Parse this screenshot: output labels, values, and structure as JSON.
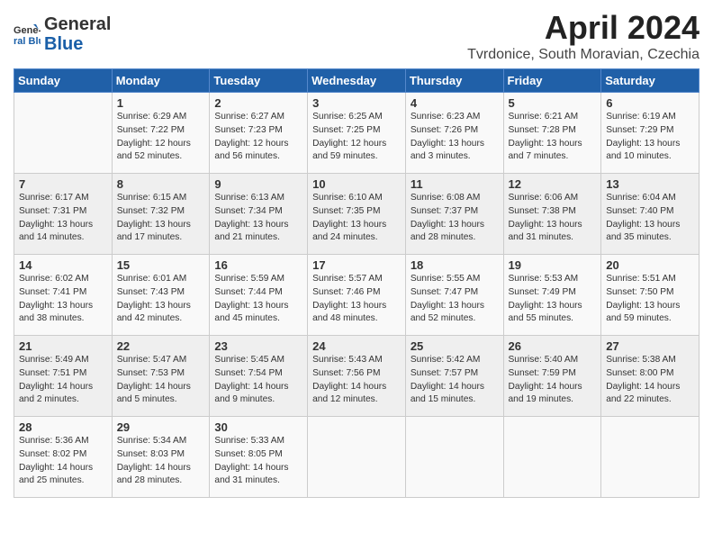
{
  "header": {
    "logo_general": "General",
    "logo_blue": "Blue",
    "title": "April 2024",
    "subtitle": "Tvrdonice, South Moravian, Czechia"
  },
  "weekdays": [
    "Sunday",
    "Monday",
    "Tuesday",
    "Wednesday",
    "Thursday",
    "Friday",
    "Saturday"
  ],
  "weeks": [
    [
      {
        "day": "",
        "sunrise": "",
        "sunset": "",
        "daylight": ""
      },
      {
        "day": "1",
        "sunrise": "6:29 AM",
        "sunset": "7:22 PM",
        "daylight": "12 hours and 52 minutes."
      },
      {
        "day": "2",
        "sunrise": "6:27 AM",
        "sunset": "7:23 PM",
        "daylight": "12 hours and 56 minutes."
      },
      {
        "day": "3",
        "sunrise": "6:25 AM",
        "sunset": "7:25 PM",
        "daylight": "12 hours and 59 minutes."
      },
      {
        "day": "4",
        "sunrise": "6:23 AM",
        "sunset": "7:26 PM",
        "daylight": "13 hours and 3 minutes."
      },
      {
        "day": "5",
        "sunrise": "6:21 AM",
        "sunset": "7:28 PM",
        "daylight": "13 hours and 7 minutes."
      },
      {
        "day": "6",
        "sunrise": "6:19 AM",
        "sunset": "7:29 PM",
        "daylight": "13 hours and 10 minutes."
      }
    ],
    [
      {
        "day": "7",
        "sunrise": "6:17 AM",
        "sunset": "7:31 PM",
        "daylight": "13 hours and 14 minutes."
      },
      {
        "day": "8",
        "sunrise": "6:15 AM",
        "sunset": "7:32 PM",
        "daylight": "13 hours and 17 minutes."
      },
      {
        "day": "9",
        "sunrise": "6:13 AM",
        "sunset": "7:34 PM",
        "daylight": "13 hours and 21 minutes."
      },
      {
        "day": "10",
        "sunrise": "6:10 AM",
        "sunset": "7:35 PM",
        "daylight": "13 hours and 24 minutes."
      },
      {
        "day": "11",
        "sunrise": "6:08 AM",
        "sunset": "7:37 PM",
        "daylight": "13 hours and 28 minutes."
      },
      {
        "day": "12",
        "sunrise": "6:06 AM",
        "sunset": "7:38 PM",
        "daylight": "13 hours and 31 minutes."
      },
      {
        "day": "13",
        "sunrise": "6:04 AM",
        "sunset": "7:40 PM",
        "daylight": "13 hours and 35 minutes."
      }
    ],
    [
      {
        "day": "14",
        "sunrise": "6:02 AM",
        "sunset": "7:41 PM",
        "daylight": "13 hours and 38 minutes."
      },
      {
        "day": "15",
        "sunrise": "6:01 AM",
        "sunset": "7:43 PM",
        "daylight": "13 hours and 42 minutes."
      },
      {
        "day": "16",
        "sunrise": "5:59 AM",
        "sunset": "7:44 PM",
        "daylight": "13 hours and 45 minutes."
      },
      {
        "day": "17",
        "sunrise": "5:57 AM",
        "sunset": "7:46 PM",
        "daylight": "13 hours and 48 minutes."
      },
      {
        "day": "18",
        "sunrise": "5:55 AM",
        "sunset": "7:47 PM",
        "daylight": "13 hours and 52 minutes."
      },
      {
        "day": "19",
        "sunrise": "5:53 AM",
        "sunset": "7:49 PM",
        "daylight": "13 hours and 55 minutes."
      },
      {
        "day": "20",
        "sunrise": "5:51 AM",
        "sunset": "7:50 PM",
        "daylight": "13 hours and 59 minutes."
      }
    ],
    [
      {
        "day": "21",
        "sunrise": "5:49 AM",
        "sunset": "7:51 PM",
        "daylight": "14 hours and 2 minutes."
      },
      {
        "day": "22",
        "sunrise": "5:47 AM",
        "sunset": "7:53 PM",
        "daylight": "14 hours and 5 minutes."
      },
      {
        "day": "23",
        "sunrise": "5:45 AM",
        "sunset": "7:54 PM",
        "daylight": "14 hours and 9 minutes."
      },
      {
        "day": "24",
        "sunrise": "5:43 AM",
        "sunset": "7:56 PM",
        "daylight": "14 hours and 12 minutes."
      },
      {
        "day": "25",
        "sunrise": "5:42 AM",
        "sunset": "7:57 PM",
        "daylight": "14 hours and 15 minutes."
      },
      {
        "day": "26",
        "sunrise": "5:40 AM",
        "sunset": "7:59 PM",
        "daylight": "14 hours and 19 minutes."
      },
      {
        "day": "27",
        "sunrise": "5:38 AM",
        "sunset": "8:00 PM",
        "daylight": "14 hours and 22 minutes."
      }
    ],
    [
      {
        "day": "28",
        "sunrise": "5:36 AM",
        "sunset": "8:02 PM",
        "daylight": "14 hours and 25 minutes."
      },
      {
        "day": "29",
        "sunrise": "5:34 AM",
        "sunset": "8:03 PM",
        "daylight": "14 hours and 28 minutes."
      },
      {
        "day": "30",
        "sunrise": "5:33 AM",
        "sunset": "8:05 PM",
        "daylight": "14 hours and 31 minutes."
      },
      {
        "day": "",
        "sunrise": "",
        "sunset": "",
        "daylight": ""
      },
      {
        "day": "",
        "sunrise": "",
        "sunset": "",
        "daylight": ""
      },
      {
        "day": "",
        "sunrise": "",
        "sunset": "",
        "daylight": ""
      },
      {
        "day": "",
        "sunrise": "",
        "sunset": "",
        "daylight": ""
      }
    ]
  ]
}
